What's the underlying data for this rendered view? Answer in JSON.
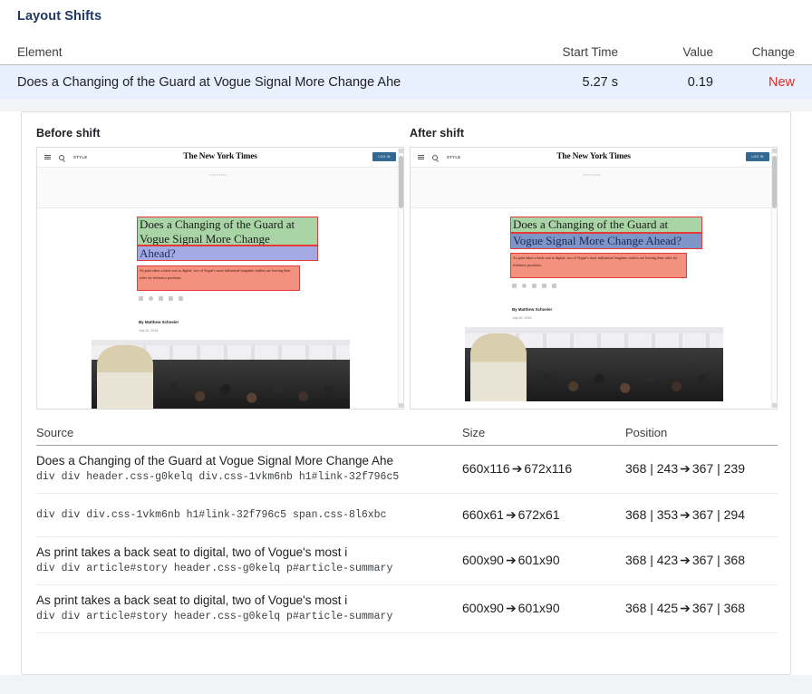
{
  "section": {
    "title": "Layout Shifts"
  },
  "summary_table": {
    "columns": [
      "Element",
      "Start Time",
      "Value",
      "Change"
    ],
    "rows": [
      {
        "element": "Does a Changing of the Guard at Vogue Signal More Change Ahe",
        "start_time": "5.27 s",
        "value": "0.19",
        "change": "New",
        "change_color": "#d93025",
        "row_highlight": "#e8f0fe"
      }
    ]
  },
  "shift_panels": {
    "before": {
      "label": "Before shift",
      "nyt": {
        "kicker": "STYLE",
        "masthead": "The New York Times",
        "login_label": "LOG IN",
        "headline_line1": "Does a Changing of the Guard at",
        "headline_line2": "Vogue Signal More Change",
        "headline_line3": "Ahead?",
        "summary": "As print takes a back seat to digital, two of Vogue's most influential longtime staffers are leaving their roles for freelance positions.",
        "byline": "By Matthew Schneier",
        "dateline": "July 30, 2018"
      }
    },
    "after": {
      "label": "After shift",
      "nyt": {
        "kicker": "STYLE",
        "masthead": "The New York Times",
        "login_label": "LOG IN",
        "headline_line1": "Does a Changing of the Guard at",
        "headline_line2": "Vogue Signal More Change Ahead?",
        "summary": "As print takes a back seat to digital, two of Vogue's most influential longtime staffers are leaving their roles for freelance positions.",
        "byline": "By Matthew Schneier",
        "dateline": "July 30, 2018"
      }
    },
    "highlight_colors": {
      "green": "#a9d5a6",
      "blue": "#a3aae4",
      "blue_strong": "#7f95c8",
      "salmon": "#f4917e",
      "border": "#e53935"
    }
  },
  "source_table": {
    "columns": [
      "Source",
      "Size",
      "Position"
    ],
    "rows": [
      {
        "title": "Does a Changing of the Guard at Vogue Signal More Change Ahe",
        "path": "div div header.css-g0kelq div.css-1vkm6nb h1#link-32f796c5",
        "size_from": "660x116",
        "size_to": "672x116",
        "pos_from": "368 | 243",
        "pos_to": "367 | 239"
      },
      {
        "title": "",
        "path": "div div div.css-1vkm6nb h1#link-32f796c5 span.css-8l6xbc",
        "size_from": "660x61",
        "size_to": "672x61",
        "pos_from": "368 | 353",
        "pos_to": "367 | 294"
      },
      {
        "title": "As print takes a back seat to digital, two of Vogue's most i",
        "path": "div div article#story header.css-g0kelq p#article-summary",
        "size_from": "600x90",
        "size_to": "601x90",
        "pos_from": "368 | 423",
        "pos_to": "367 | 368"
      },
      {
        "title": "As print takes a back seat to digital, two of Vogue's most i",
        "path": "div div article#story header.css-g0kelq p#article-summary",
        "size_from": "600x90",
        "size_to": "601x90",
        "pos_from": "368 | 425",
        "pos_to": "367 | 368"
      }
    ],
    "arrow_glyph": "➔"
  }
}
